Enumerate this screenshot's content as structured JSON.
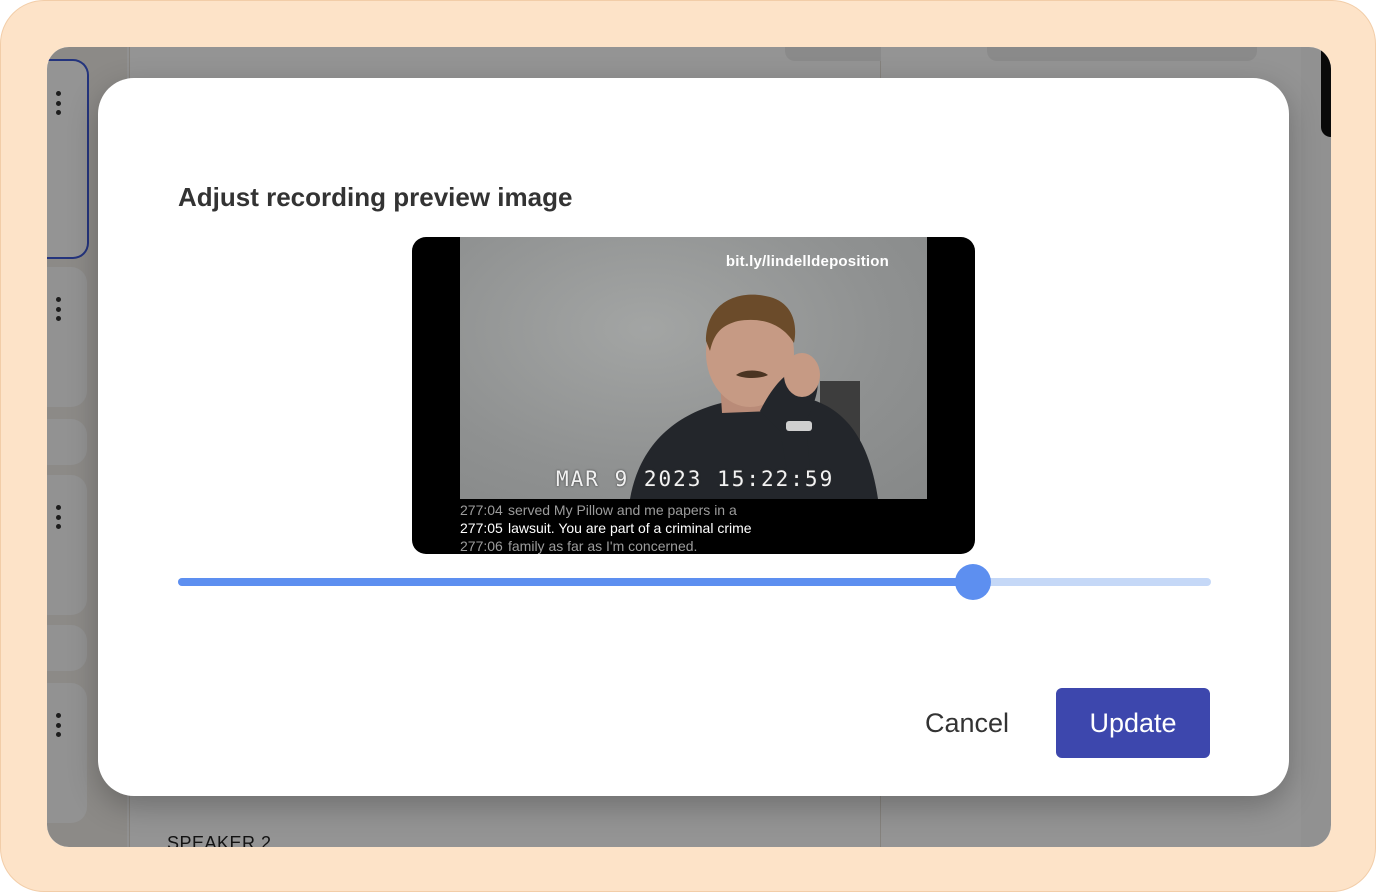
{
  "dialog": {
    "title": "Adjust recording preview image",
    "preview": {
      "watermark": "bit.ly/lindelldeposition",
      "timestamp": "MAR  9 2023 15:22:59",
      "transcript": [
        {
          "num": "277:04",
          "text": "served My Pillow and me papers in a"
        },
        {
          "num": "277:05",
          "text": "lawsuit.  You are part of a criminal crime"
        },
        {
          "num": "277:06",
          "text": "family as far as I'm concerned."
        }
      ]
    },
    "slider": {
      "value_fraction": 0.77
    },
    "cancel_label": "Cancel",
    "update_label": "Update"
  },
  "background": {
    "speaker_label": "SPEAKER 2"
  },
  "colors": {
    "accent": "#3d47ad",
    "slider_fill": "#5d8ff0",
    "slider_track": "#c5d8f7",
    "frame": "#fde3c8"
  }
}
